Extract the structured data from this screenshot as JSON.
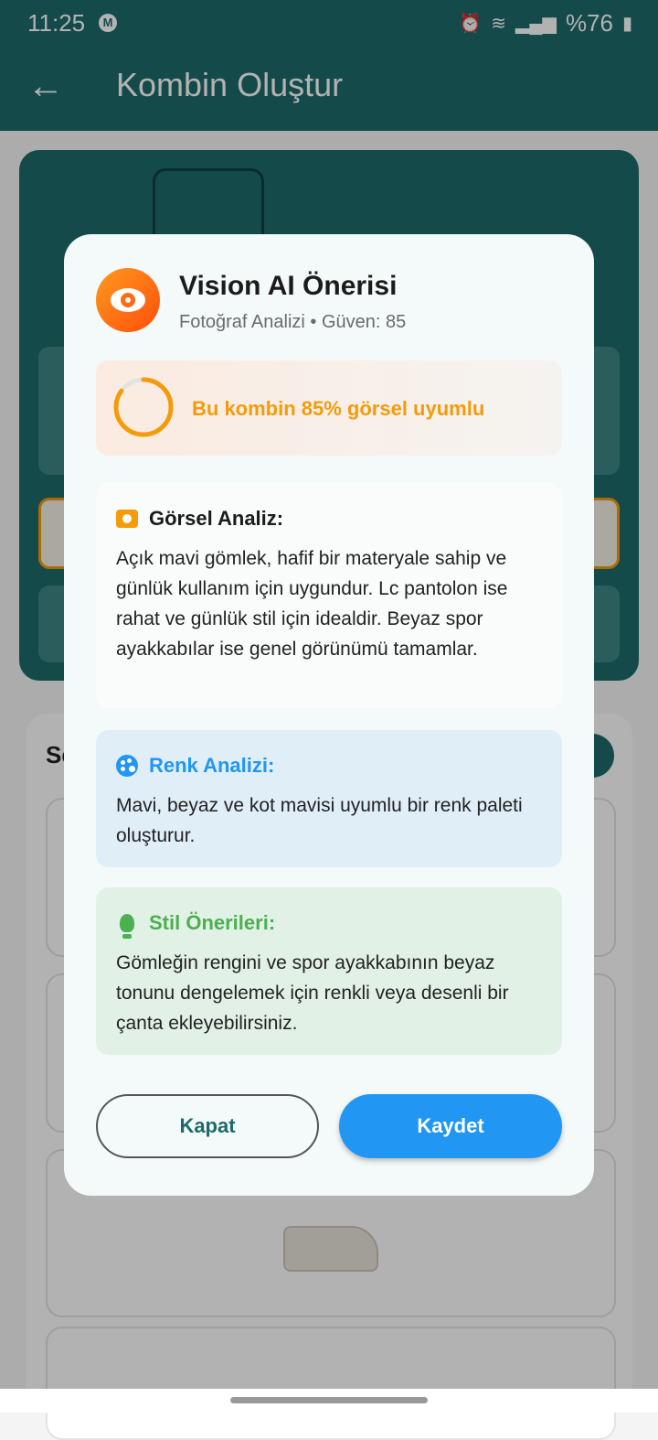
{
  "status": {
    "time": "11:25",
    "battery": "%76"
  },
  "appbar": {
    "title": "Kombin Oluştur"
  },
  "background": {
    "list_heading": "Se"
  },
  "dialog": {
    "title": "Vision AI Önerisi",
    "subtitle": "Fotoğraf Analizi • Güven: 85",
    "score_text": "Bu kombin 85% görsel uyumlu",
    "score_percent": 85,
    "visual": {
      "title": "Görsel Analiz:",
      "body": "Açık mavi gömlek, hafif bir materyale sahip ve günlük kullanım için uygundur. Lc pantolon ise rahat ve günlük stil için idealdir. Beyaz spor ayakkabılar ise genel görünümü tamamlar."
    },
    "color": {
      "title": "Renk Analizi:",
      "body": "Mavi, beyaz ve kot mavisi uyumlu bir renk paleti oluşturur."
    },
    "style": {
      "title": "Stil Önerileri:",
      "body": "Gömleğin rengini ve spor ayakkabının beyaz tonunu dengelemek için renkli veya desenli bir çanta ekleyebilirsiniz."
    },
    "close_label": "Kapat",
    "save_label": "Kaydet"
  },
  "colors": {
    "primary": "#1d6a6a",
    "accent_orange": "#f59b0b",
    "info_blue": "#2196f3",
    "success_green": "#4caf50"
  }
}
